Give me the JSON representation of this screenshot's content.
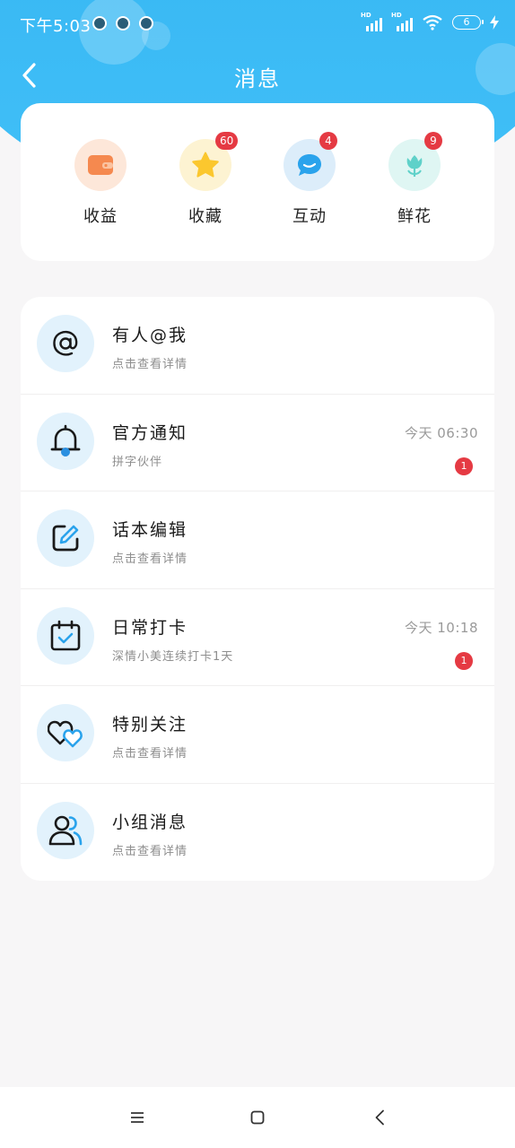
{
  "status_bar": {
    "time": "下午5:03",
    "battery": "6"
  },
  "header": {
    "title": "消息"
  },
  "categories": [
    {
      "label": "收益",
      "badge": "",
      "icon": "wallet-icon",
      "color": "#f5894f",
      "bg": "#fde7d9"
    },
    {
      "label": "收藏",
      "badge": "60",
      "icon": "star-icon",
      "color": "#fbc72e",
      "bg": "#fdf3d2"
    },
    {
      "label": "互动",
      "badge": "4",
      "icon": "chat-bubble-icon",
      "color": "#2aa3ec",
      "bg": "#dcedfa"
    },
    {
      "label": "鲜花",
      "badge": "9",
      "icon": "flower-icon",
      "color": "#5fd1c9",
      "bg": "#dff6f3"
    }
  ],
  "messages": [
    {
      "title": "有人@我",
      "subtitle": "点击查看详情",
      "time": "",
      "badge": "",
      "icon": "at-sign-icon"
    },
    {
      "title": "官方通知",
      "subtitle": "拼字伙伴",
      "time": "今天 06:30",
      "badge": "1",
      "icon": "bell-icon"
    },
    {
      "title": "话本编辑",
      "subtitle": "点击查看详情",
      "time": "",
      "badge": "",
      "icon": "edit-icon"
    },
    {
      "title": "日常打卡",
      "subtitle": "深情小美连续打卡1天",
      "time": "今天 10:18",
      "badge": "1",
      "icon": "calendar-check-icon"
    },
    {
      "title": "特别关注",
      "subtitle": "点击查看详情",
      "time": "",
      "badge": "",
      "icon": "hearts-icon"
    },
    {
      "title": "小组消息",
      "subtitle": "点击查看详情",
      "time": "",
      "badge": "",
      "icon": "group-icon"
    }
  ],
  "colors": {
    "header_blue": "#3ab9f4",
    "accent_blue": "#2aa3ec",
    "badge_red": "#e53a43"
  },
  "nav": [
    "menu-icon",
    "home-icon",
    "back-icon"
  ]
}
